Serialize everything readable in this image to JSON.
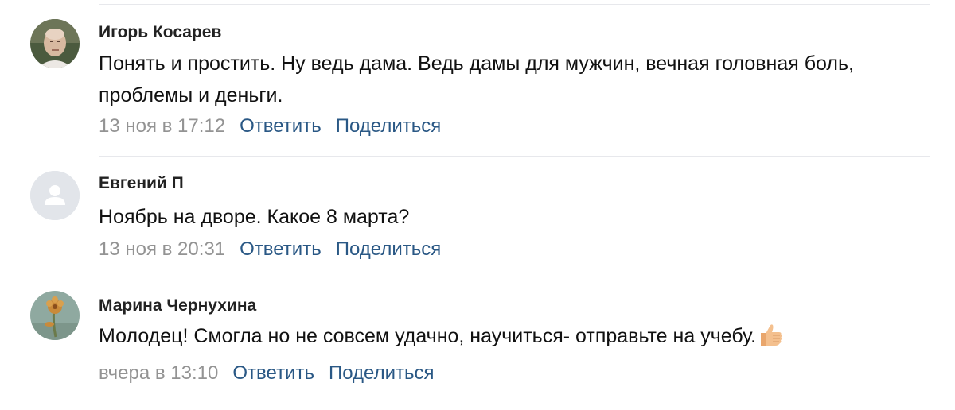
{
  "comments": [
    {
      "author": "Игорь Косарев",
      "text": "Понять и простить. Ну ведь дама. Ведь дамы для мужчин, вечная головная боль, проблемы и деньги.",
      "date": "13 ноя в 17:12",
      "reply_label": "Ответить",
      "share_label": "Поделиться"
    },
    {
      "author": "Евгений П",
      "text": "Ноябрь на дворе. Какое 8 марта?",
      "date": "13 ноя в 20:31",
      "reply_label": "Ответить",
      "share_label": "Поделиться"
    },
    {
      "author": "Марина Чернухина",
      "text": "Молодец! Смогла но не совсем удачно, научиться- отправьте на учебу.",
      "date": "вчера в 13:10",
      "reply_label": "Ответить",
      "share_label": "Поделиться"
    }
  ],
  "icons": {
    "thumbs_up": "thumbs-up-emoji",
    "default_avatar": "user-silhouette-icon"
  },
  "colors": {
    "link": "#2a5885",
    "date": "#939393",
    "divider": "#e7e8ec",
    "default_avatar_bg": "#e2e5ea"
  }
}
